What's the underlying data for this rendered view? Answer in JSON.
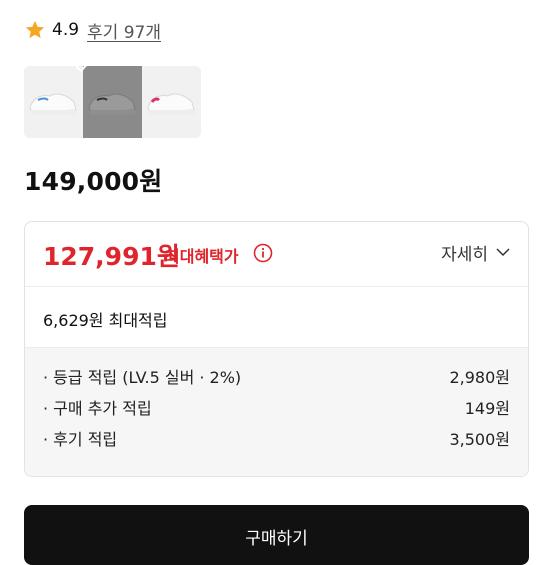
{
  "rating": {
    "value": "4.9",
    "review_link": "후기 97개",
    "star_color": "#F5A623"
  },
  "swatches": [
    {
      "name": "white-blue",
      "selected": false
    },
    {
      "name": "white-black",
      "selected": true
    },
    {
      "name": "white-pink",
      "selected": false
    }
  ],
  "price": {
    "original": "149,000원",
    "sale": "127,991원",
    "benefit_label": "최대혜택가",
    "detail_button": "자세히",
    "sale_color": "#E0242B"
  },
  "points": {
    "total": "6,629원 최대적립",
    "items": [
      {
        "label": "· 등급 적립 (LV.5 실버 · 2%)",
        "value": "2,980원"
      },
      {
        "label": "· 구매 추가 적립",
        "value": "149원"
      },
      {
        "label": "· 후기 적립",
        "value": "3,500원"
      }
    ]
  },
  "buy_button": {
    "label": "구매하기"
  }
}
